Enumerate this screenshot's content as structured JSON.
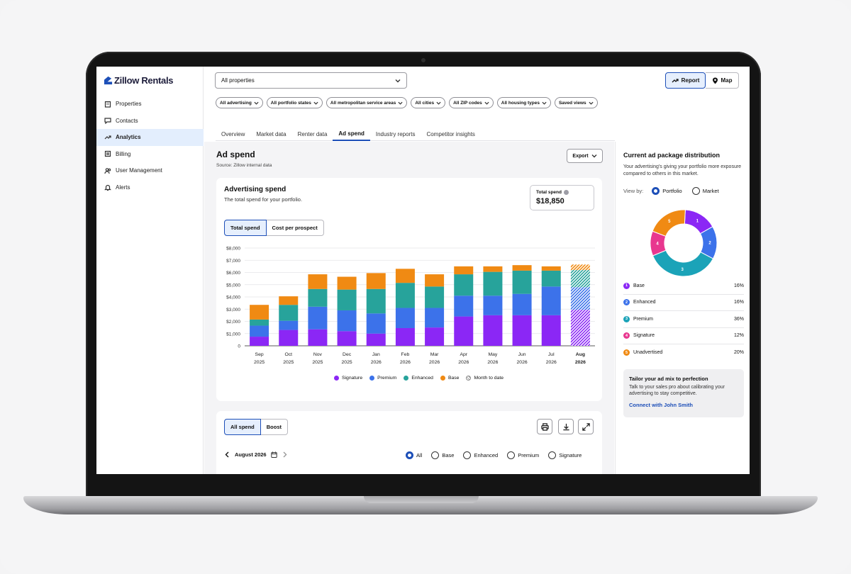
{
  "app": {
    "logo_text": "Zillow Rentals"
  },
  "sidebar": {
    "items": [
      {
        "label": "Properties",
        "icon": "building-icon",
        "active": false
      },
      {
        "label": "Contacts",
        "icon": "chat-icon",
        "active": false
      },
      {
        "label": "Analytics",
        "icon": "trend-icon",
        "active": true
      },
      {
        "label": "Billing",
        "icon": "bill-icon",
        "active": false
      },
      {
        "label": "User Management",
        "icon": "users-icon",
        "active": false
      },
      {
        "label": "Alerts",
        "icon": "bell-icon",
        "active": false
      }
    ]
  },
  "topbar": {
    "property_select": "All properties",
    "report_label": "Report",
    "map_label": "Map"
  },
  "filters": [
    "All advertising",
    "All portfolio states",
    "All metropolitan service areas",
    "All cities",
    "All ZIP codes",
    "All housing types",
    "Saved views"
  ],
  "tabs": [
    {
      "label": "Overview",
      "active": false
    },
    {
      "label": "Market data",
      "active": false
    },
    {
      "label": "Renter data",
      "active": false
    },
    {
      "label": "Ad spend",
      "active": true
    },
    {
      "label": "Industry reports",
      "active": false
    },
    {
      "label": "Competitor insights",
      "active": false
    }
  ],
  "main": {
    "title": "Ad spend",
    "source": "Source: Zillow internal data",
    "export_label": "Export"
  },
  "spend_card": {
    "title": "Advertising spend",
    "subtitle": "The total spend for your portfolio.",
    "total_label": "Total spend",
    "total_value": "$18,850",
    "toggle": [
      "Total spend",
      "Cost per prospect"
    ]
  },
  "chart_data": {
    "type": "bar",
    "stacked": true,
    "categories": [
      {
        "month": "Sep",
        "year": "2025"
      },
      {
        "month": "Oct",
        "year": "2025"
      },
      {
        "month": "Nov",
        "year": "2025"
      },
      {
        "month": "Dec",
        "year": "2025"
      },
      {
        "month": "Jan",
        "year": "2026"
      },
      {
        "month": "Feb",
        "year": "2026"
      },
      {
        "month": "Mar",
        "year": "2026"
      },
      {
        "month": "Apr",
        "year": "2026"
      },
      {
        "month": "May",
        "year": "2026"
      },
      {
        "month": "Jun",
        "year": "2026"
      },
      {
        "month": "Jul",
        "year": "2026"
      },
      {
        "month": "Aug",
        "year": "2026",
        "month_to_date": true
      }
    ],
    "series": [
      {
        "name": "Signature",
        "color": "#8b27f5",
        "values": [
          750,
          1300,
          1350,
          1200,
          1000,
          1450,
          1500,
          2400,
          2500,
          2500,
          2500,
          2950
        ]
      },
      {
        "name": "Premium",
        "color": "#3c72ea",
        "values": [
          900,
          750,
          1850,
          1700,
          1650,
          1650,
          1600,
          1700,
          1600,
          1750,
          2350,
          1850
        ]
      },
      {
        "name": "Enhanced",
        "color": "#27a39b",
        "values": [
          500,
          1300,
          1450,
          1700,
          2000,
          2050,
          1750,
          1750,
          1950,
          1900,
          1300,
          1400
        ]
      },
      {
        "name": "Base",
        "color": "#f08a13",
        "values": [
          1200,
          700,
          1200,
          1050,
          1300,
          1150,
          1000,
          650,
          450,
          450,
          350,
          450
        ]
      }
    ],
    "legend_extra": "Month to date",
    "y_ticks": [
      "$8,000",
      "$7,000",
      "$6,000",
      "$5,000",
      "$4,000",
      "$3,000",
      "$2,000",
      "$1,000",
      "0"
    ],
    "ylim": [
      0,
      8000
    ],
    "grid": true,
    "legend_position": "bottom"
  },
  "table_card": {
    "toggle": [
      "All spend",
      "Boost"
    ],
    "month": "August 2026",
    "filters": [
      {
        "label": "All",
        "selected": true
      },
      {
        "label": "Base",
        "selected": false
      },
      {
        "label": "Enhanced",
        "selected": false
      },
      {
        "label": "Premium",
        "selected": false
      },
      {
        "label": "Signature",
        "selected": false
      }
    ]
  },
  "distribution": {
    "title": "Current ad package distribution",
    "subtitle": "Your advertising's giving your portfolio more exposure compared to others in this market.",
    "view_by_label": "View by:",
    "view_options": [
      {
        "label": "Portfolio",
        "selected": true
      },
      {
        "label": "Market",
        "selected": false
      }
    ],
    "items": [
      {
        "num": "1",
        "label": "Base",
        "value": "16%",
        "pct": 16,
        "color": "#8b27f5"
      },
      {
        "num": "2",
        "label": "Enhanced",
        "value": "16%",
        "pct": 16,
        "color": "#3c72ea"
      },
      {
        "num": "3",
        "label": "Premium",
        "value": "36%",
        "pct": 36,
        "color": "#1ba3b8"
      },
      {
        "num": "4",
        "label": "Signature",
        "value": "12%",
        "pct": 12,
        "color": "#e8378f"
      },
      {
        "num": "5",
        "label": "Unadvertised",
        "value": "20%",
        "pct": 20,
        "color": "#f08a13"
      }
    ]
  },
  "promo": {
    "title": "Tailor your ad mix to perfection",
    "body": "Talk to your sales pro about calibrating your advertising to stay competitive.",
    "link": "Connect with John Smith"
  }
}
